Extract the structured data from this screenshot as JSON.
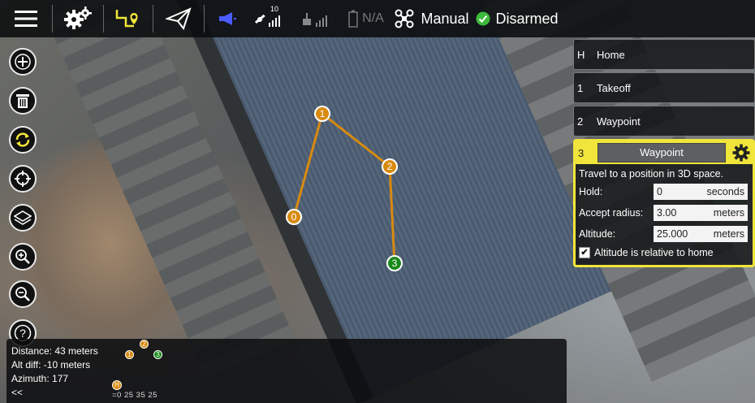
{
  "topbar": {
    "menu_icon": "hamburger-menu-icon",
    "settings_icon": "gears-icon",
    "plan_icon": "flight-plan-icon",
    "fly_icon": "paper-plane-icon",
    "message_icon": "megaphone-icon",
    "gps_count": "10",
    "battery_text": "N/A",
    "flight_mode": "Manual",
    "arm_status": "Disarmed",
    "arm_color": "#3cba3c"
  },
  "left_toolbar": [
    {
      "name": "add-icon",
      "symbol": "+"
    },
    {
      "name": "trash-icon",
      "symbol": "trash"
    },
    {
      "name": "sync-icon",
      "symbol": "sync"
    },
    {
      "name": "crosshair-icon",
      "symbol": "center"
    },
    {
      "name": "layers-icon",
      "symbol": "layers"
    },
    {
      "name": "zoom-in-icon",
      "symbol": "zoom-in"
    },
    {
      "name": "zoom-out-icon",
      "symbol": "zoom-out"
    },
    {
      "name": "help-icon",
      "symbol": "?"
    }
  ],
  "mission": {
    "items": [
      {
        "index": "H",
        "label": "Home"
      },
      {
        "index": "1",
        "label": "Takeoff"
      },
      {
        "index": "2",
        "label": "Waypoint"
      }
    ],
    "editor": {
      "index": "3",
      "command": "Waypoint",
      "description": "Travel to a position in 3D space.",
      "hold_label": "Hold:",
      "hold_value": "0",
      "hold_unit": "seconds",
      "radius_label": "Accept radius:",
      "radius_value": "3.00",
      "radius_unit": "meters",
      "altitude_label": "Altitude:",
      "altitude_value": "25.000",
      "altitude_unit": "meters",
      "relative_checked": "✔",
      "relative_label": "Altitude is relative to home",
      "accent_color": "#f0e53a"
    }
  },
  "map_markers": [
    {
      "label": "0",
      "color": "#d88a10"
    },
    {
      "label": "1",
      "color": "#d88a10"
    },
    {
      "label": "2",
      "color": "#d88a10"
    },
    {
      "label": "3",
      "color": "#1a8a1a"
    }
  ],
  "status": {
    "distance": "Distance: 43 meters",
    "alt_diff": "Alt diff: -10 meters",
    "azimuth": "Azimuth: 177",
    "collapse": "<<"
  },
  "altitude_chart": {
    "home_label": "H",
    "markers": [
      "1",
      "2",
      "3"
    ],
    "ticks": "=0 25 35 25"
  }
}
